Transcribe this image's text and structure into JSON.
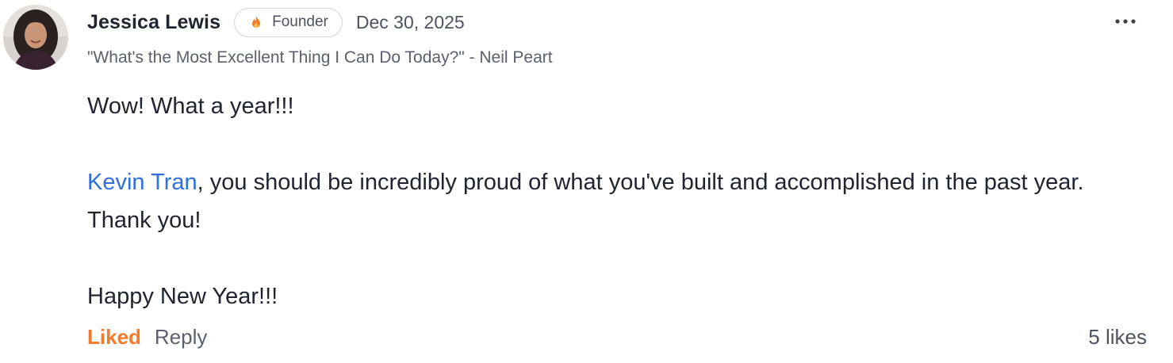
{
  "comment": {
    "author": "Jessica Lewis",
    "badge": {
      "icon": "fire-icon",
      "label": "Founder"
    },
    "date": "Dec 30, 2025",
    "bio": "\"What's the Most Excellent Thing I Can Do Today?\" - Neil Peart",
    "body": {
      "line1": "Wow! What a year!!!",
      "mention": "Kevin Tran",
      "line2_after_mention": ", you should be incredibly proud of what you've built and accomplished in the past year. Thank you!",
      "line3": "Happy New Year!!!"
    },
    "actions": {
      "liked_label": "Liked",
      "reply_label": "Reply",
      "likes_count": "5 likes"
    },
    "menu_icon": "more-horizontal-icon"
  },
  "colors": {
    "mention": "#2f6fe0",
    "liked": "#f07b2b",
    "badge_flame": "#f07b2b"
  }
}
